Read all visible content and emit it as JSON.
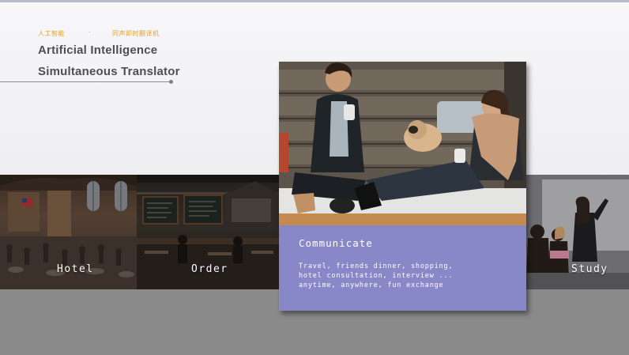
{
  "header": {
    "tag_left": "人工智能",
    "tag_dot": "·",
    "tag_right": "同声即时翻译机",
    "title_line1": "Artificial Intelligence",
    "title_line2": "Simultaneous Translator"
  },
  "scenes": {
    "hotel": "Hotel",
    "order": "Order",
    "study": "Study"
  },
  "card": {
    "title": "Communicate",
    "lines": [
      "Travel, friends dinner, shopping,",
      "hotel consultation, interview ...",
      "anytime, anywhere, fun exchange"
    ]
  },
  "colors": {
    "accent": "#e2a22c",
    "card_panel": "#8888c9",
    "title_text": "#4f4f4f",
    "bottom_band": "#8a8a8a"
  }
}
